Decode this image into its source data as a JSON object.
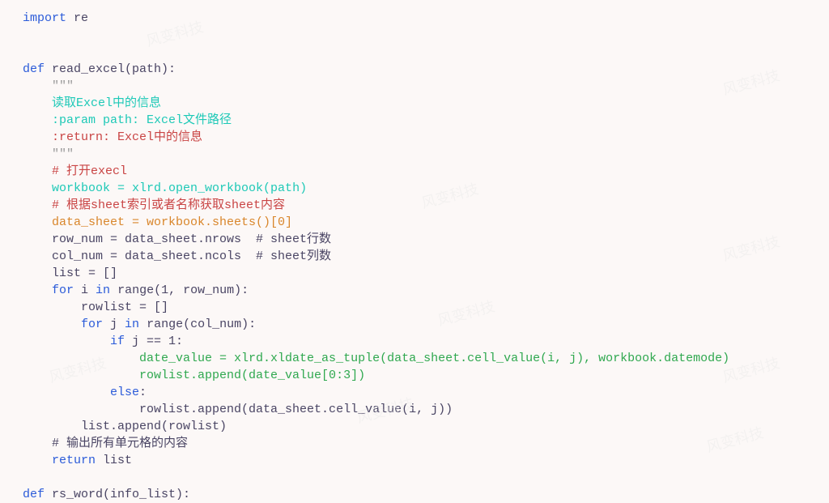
{
  "code": {
    "l01_a": "import",
    "l01_b": " re",
    "blank1": "",
    "blank2": "",
    "l02_a": "def",
    "l02_b": " read_excel(path):",
    "l03": "    \"\"\"",
    "l04": "    读取Excel中的信息",
    "l05": "    :param path: Excel文件路径",
    "l06": "    :return: Excel中的信息",
    "l07": "    \"\"\"",
    "l08": "    # 打开execl",
    "l09_a": "    workbook = ",
    "l09_b": "xlrd.open_workbook(path)",
    "l10": "    # 根据sheet索引或者名称获取sheet内容",
    "l11_a": "    data_sheet = ",
    "l11_b": "workbook.sheets()[0]",
    "l12_a": "    row_num = data_sheet.nrows  ",
    "l12_b": "# sheet行数",
    "l13_a": "    col_num = data_sheet.ncols  ",
    "l13_b": "# sheet列数",
    "l14": "    list = []",
    "l15_a": "    ",
    "l15_b": "for",
    "l15_c": " i ",
    "l15_d": "in",
    "l15_e": " range(1, row_num):",
    "l16": "        rowlist = []",
    "l17_a": "        ",
    "l17_b": "for",
    "l17_c": " j ",
    "l17_d": "in",
    "l17_e": " range(col_num):",
    "l18_a": "            ",
    "l18_b": "if",
    "l18_c": " j == 1:",
    "l19": "                date_value = xlrd.xldate_as_tuple(data_sheet.cell_value(i, j), workbook.datemode)",
    "l20": "                rowlist.append(date_value[0:3])",
    "l21_a": "            ",
    "l21_b": "else",
    "l21_c": ":",
    "l22": "                rowlist.append(data_sheet.cell_value(i, j))",
    "l23": "        list.append(rowlist)",
    "l24_a": "    ",
    "l24_b": "# 输出所有单元格的内容",
    "l25_a": "    ",
    "l25_b": "return",
    "l25_c": " list",
    "blank3": "",
    "l26_a": "def",
    "l26_b": " rs_word(info_list):"
  },
  "watermark": "风变科技"
}
